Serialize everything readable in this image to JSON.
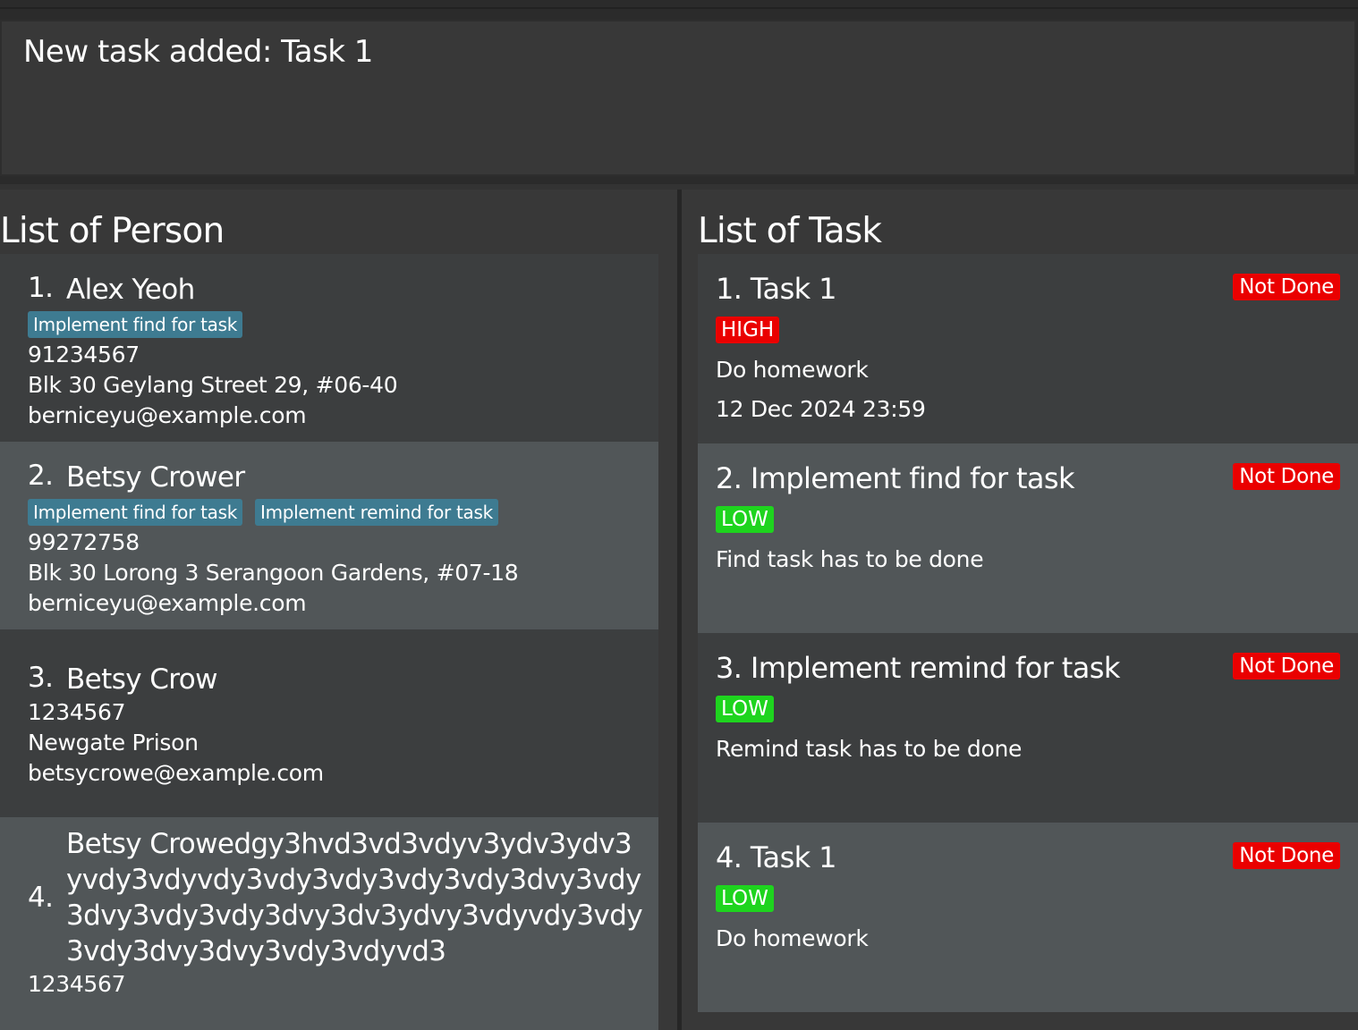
{
  "result_display": {
    "text": "New task added: Task 1"
  },
  "person_panel": {
    "title": "List of Person",
    "persons": [
      {
        "index": "1.",
        "name": "Alex Yeoh",
        "tags": [
          "Implement find for task"
        ],
        "phone": "91234567",
        "address": "Blk 30 Geylang Street 29, #06-40",
        "email": "berniceyu@example.com"
      },
      {
        "index": "2.",
        "name": "Betsy Crower",
        "tags": [
          "Implement find for task",
          "Implement remind for task"
        ],
        "phone": "99272758",
        "address": "Blk 30 Lorong 3 Serangoon Gardens, #07-18",
        "email": "berniceyu@example.com"
      },
      {
        "index": "3.",
        "name": "Betsy Crow",
        "tags": [],
        "phone": "1234567",
        "address": "Newgate Prison",
        "email": "betsycrowe@example.com"
      },
      {
        "index": "4.",
        "name": "Betsy Crowedgy3hvd3vd3vdyv3ydv3ydv3yvdy3vdyvdy3vdy3vdy3vdy3vdy3dvy3vdy3dvy3vdy3vdy3dvy3dv3ydvy3vdyvdy3vdy3vdy3dvy3dvy3vdy3vdyvd3",
        "tags": [],
        "phone": "1234567",
        "address": "",
        "email": ""
      }
    ]
  },
  "task_panel": {
    "title": "List of Task",
    "tasks": [
      {
        "title": "1. Task 1",
        "status": "Not Done",
        "priority": "HIGH",
        "description": "Do homework",
        "deadline": "12 Dec 2024 23:59"
      },
      {
        "title": "2. Implement find for task",
        "status": "Not Done",
        "priority": "LOW",
        "description": "Find task has to be done",
        "deadline": ""
      },
      {
        "title": "3. Implement remind for task",
        "status": "Not Done",
        "priority": "LOW",
        "description": "Remind task has to be done",
        "deadline": ""
      },
      {
        "title": "4. Task 1",
        "status": "Not Done",
        "priority": "LOW",
        "description": "Do homework",
        "deadline": ""
      }
    ]
  },
  "colors": {
    "status_not_done": "#ea0000",
    "priority_high": "#ea0000",
    "priority_low": "#1ed41e",
    "tag_bg": "#3e7b91"
  }
}
